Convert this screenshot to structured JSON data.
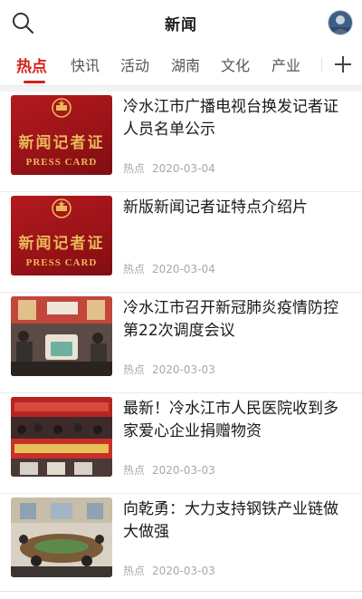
{
  "header": {
    "title": "新闻",
    "search_icon": "search-icon",
    "avatar_icon": "user-avatar"
  },
  "tabs": [
    {
      "label": "热点",
      "active": true
    },
    {
      "label": "快讯",
      "active": false
    },
    {
      "label": "活动",
      "active": false
    },
    {
      "label": "湖南",
      "active": false
    },
    {
      "label": "文化",
      "active": false
    },
    {
      "label": "产业",
      "active": false
    }
  ],
  "add_tab_icon": "plus-icon",
  "colors": {
    "accent": "#d4211c",
    "meta": "#a8a8a8",
    "divider": "#ececec"
  },
  "news": [
    {
      "title": "冷水江市广播电视台换发记者证人员名单公示",
      "tag": "热点",
      "date": "2020-03-04",
      "thumb": "press-card-image"
    },
    {
      "title": "新版新闻记者证特点介绍片",
      "tag": "热点",
      "date": "2020-03-04",
      "thumb": "press-card-image"
    },
    {
      "title": "冷水江市召开新冠肺炎疫情防控第22次调度会议",
      "tag": "热点",
      "date": "2020-03-03",
      "thumb": "meeting-photo"
    },
    {
      "title": "最新！冷水江市人民医院收到多家爱心企业捐赠物资",
      "tag": "热点",
      "date": "2020-03-03",
      "thumb": "donation-photo"
    },
    {
      "title": "向乾勇：大力支持钢铁产业链做大做强",
      "tag": "热点",
      "date": "2020-03-03",
      "thumb": "conference-photo"
    }
  ],
  "press_card": {
    "zh": "新闻记者证",
    "en": "PRESS CARD"
  }
}
